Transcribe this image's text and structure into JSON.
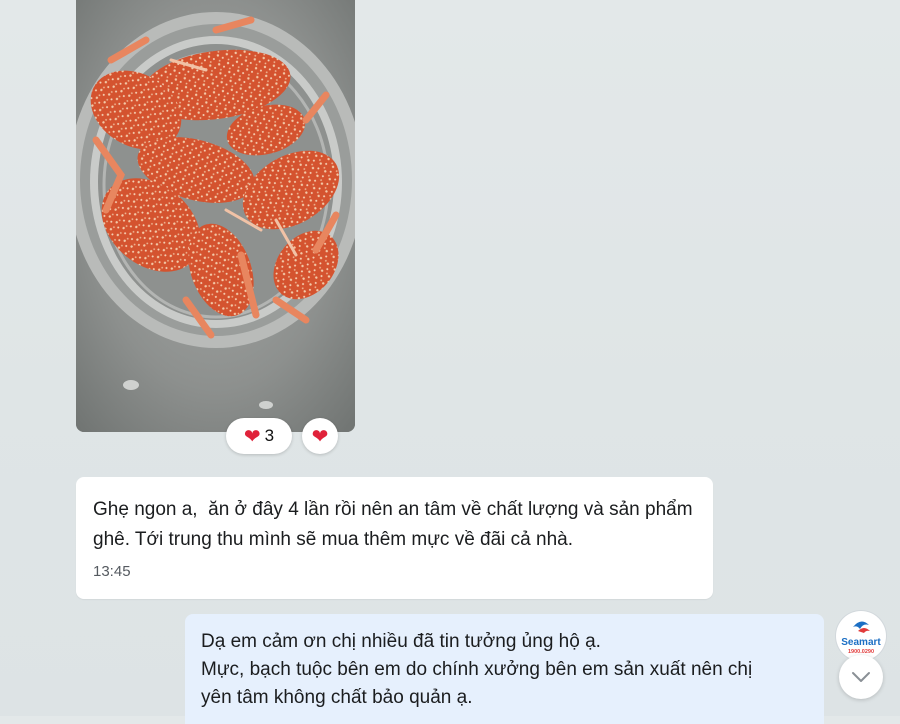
{
  "photo_message": {
    "image": "crab-photo",
    "reactions": {
      "icon": "heart-icon",
      "emoji": "❤",
      "count": "3"
    },
    "react_button_emoji": "❤"
  },
  "incoming_message": {
    "text": "Ghẹ ngon a,  ăn ở đây 4 lần rồi nên an tâm về chất lượng và sản phẩm ghê. Tới trung thu mình sẽ mua thêm mực về đãi cả nhà.",
    "time": "13:45"
  },
  "outgoing_message": {
    "lines": [
      "Dạ em cảm ơn chị nhiều đã tin tưởng ủng hộ ạ.",
      "Mực, bạch tuộc bên em do chính xưởng bên em sản xuất nên chị",
      "yên tâm không chất bảo quản ạ."
    ]
  },
  "avatar": {
    "brand": "Seamart",
    "phone": "1900.0290"
  },
  "colors": {
    "outgoing_bubble": "#e6f0fd",
    "incoming_bubble": "#ffffff",
    "heart": "#e0223a",
    "brand_blue": "#1c6fc4",
    "brand_red": "#e23b3b"
  }
}
